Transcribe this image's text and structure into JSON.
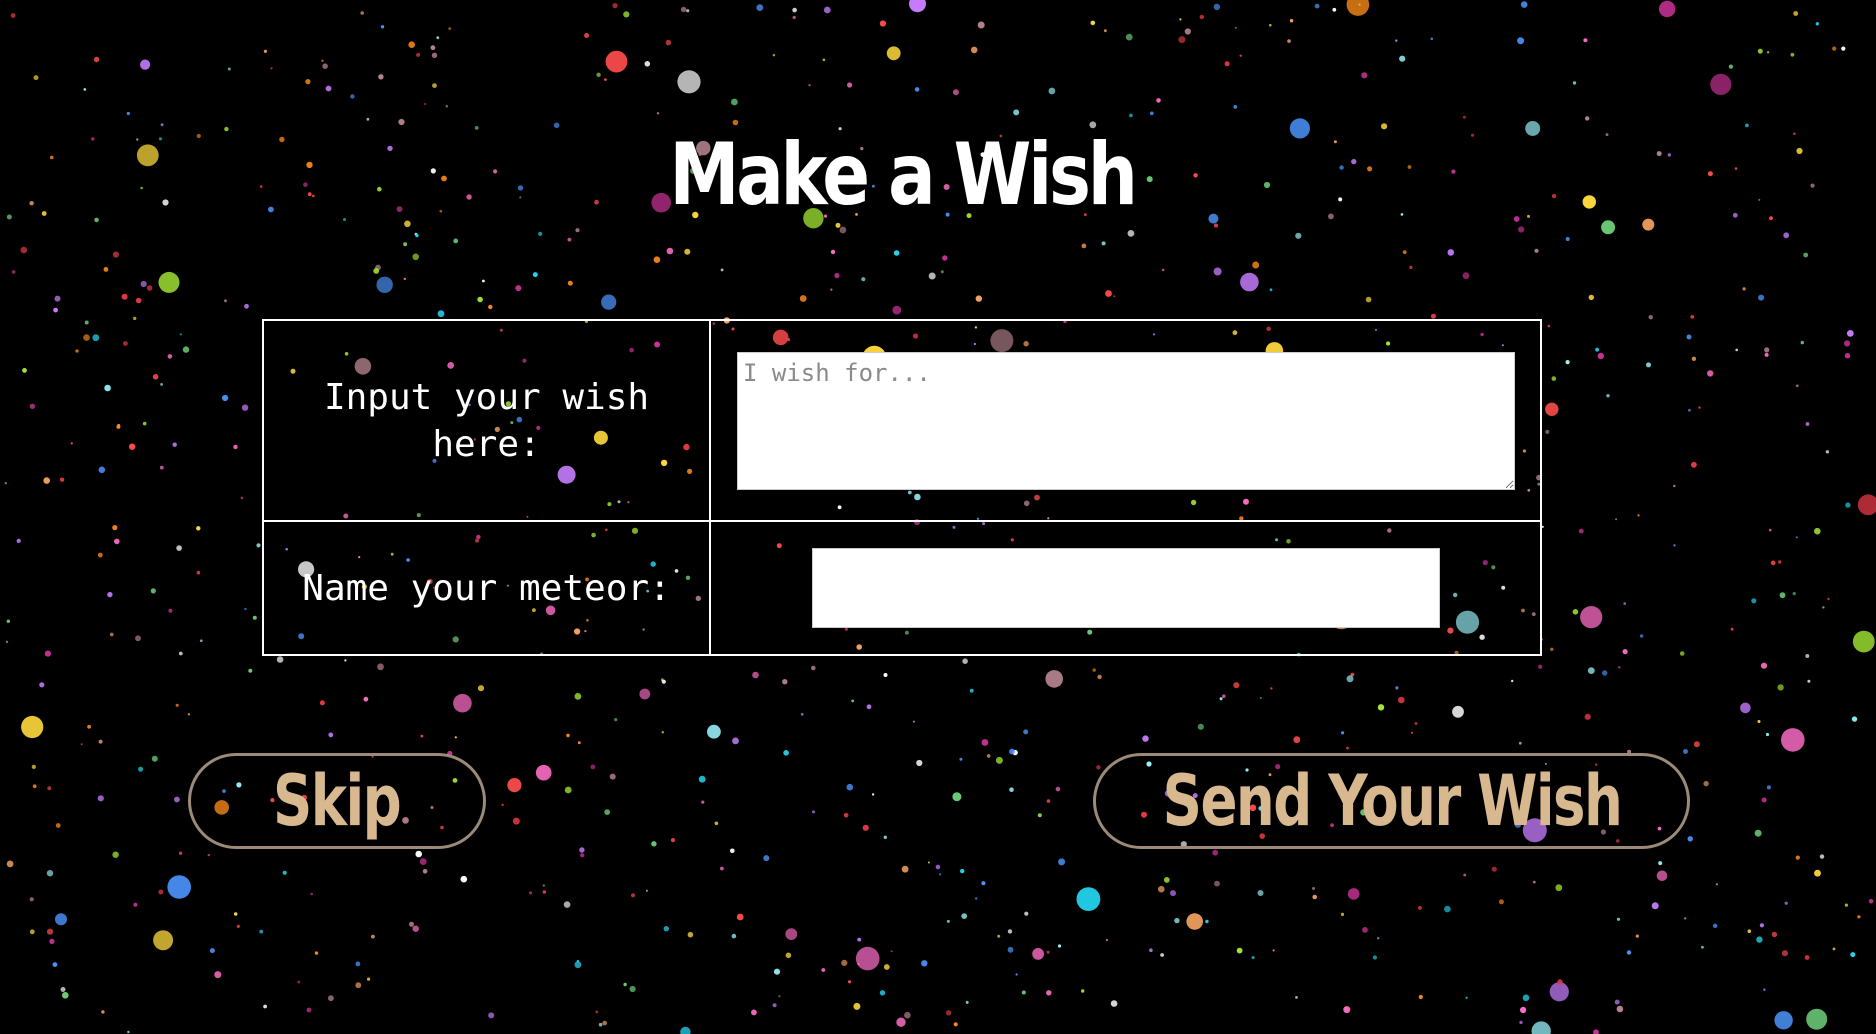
{
  "page": {
    "title": "Make a Wish",
    "background_color": "#000000"
  },
  "form": {
    "wish_label": "Input your wish here:",
    "wish_placeholder": "I wish for...",
    "wish_value": "",
    "meteor_label": "Name your meteor:",
    "meteor_value": ""
  },
  "buttons": {
    "skip_label": "Skip",
    "send_label": "Send Your Wish"
  },
  "colors": {
    "title_text": "#ffffff",
    "button_text": "#d8b88e",
    "button_border": "#9c8a78",
    "table_border": "#ffffff"
  },
  "decorations": {
    "starfield_colors": [
      "#ff4d4d",
      "#ffd93d",
      "#6bcb77",
      "#4d96ff",
      "#c77dff",
      "#ff6ec7",
      "#f4a261",
      "#9bf6ff",
      "#e63946",
      "#ffffff",
      "#ff8c1a",
      "#a3e635",
      "#22d3ee",
      "#b5838d",
      "#cc3399"
    ]
  }
}
